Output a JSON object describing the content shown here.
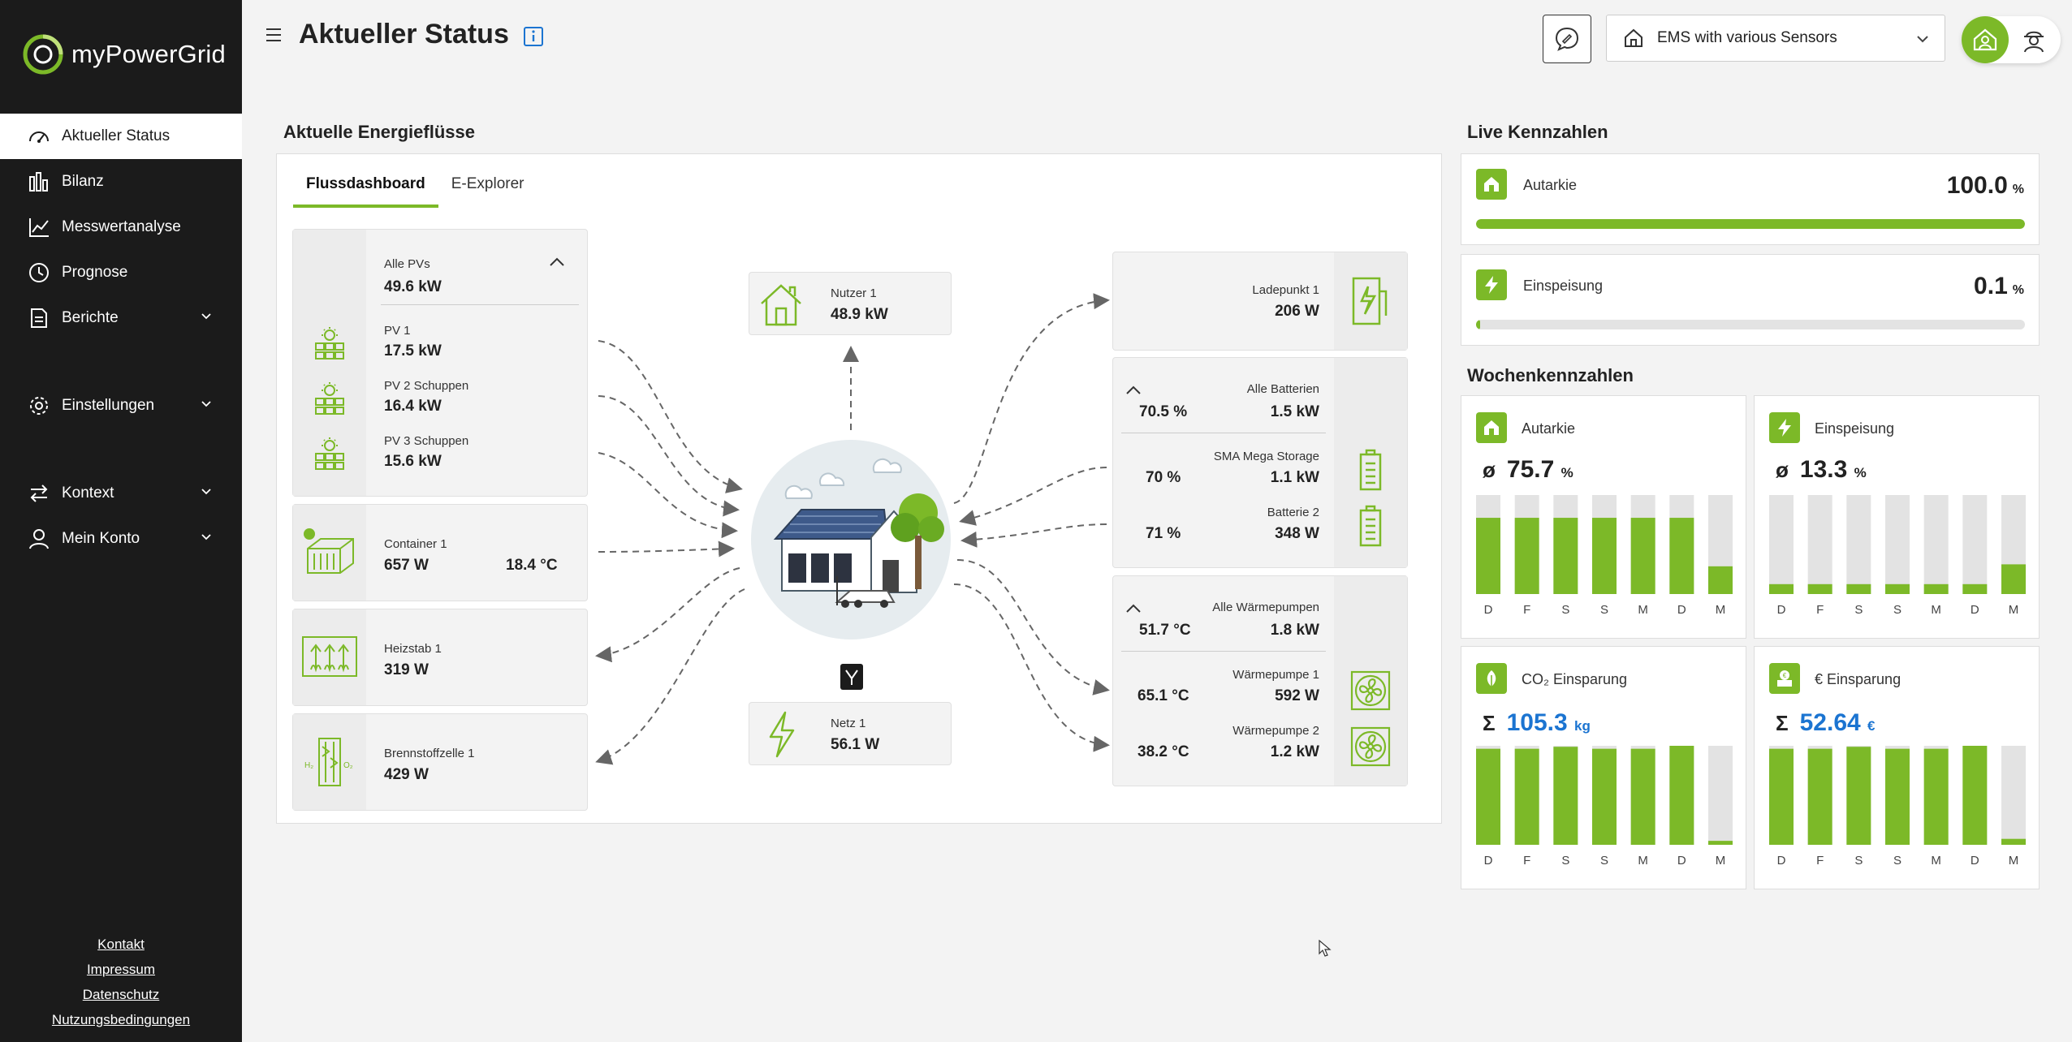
{
  "app": {
    "name": "myPowerGrid"
  },
  "sidebar": {
    "items": [
      {
        "label": "Aktueller Status",
        "icon": "gauge-icon",
        "active": true
      },
      {
        "label": "Bilanz",
        "icon": "bar-chart-icon"
      },
      {
        "label": "Messwertanalyse",
        "icon": "line-chart-icon"
      },
      {
        "label": "Prognose",
        "icon": "clock-icon"
      },
      {
        "label": "Berichte",
        "icon": "document-icon",
        "expandable": true
      },
      {
        "label": "Einstellungen",
        "icon": "gear-icon",
        "expandable": true
      },
      {
        "label": "Kontext",
        "icon": "swap-icon",
        "expandable": true
      },
      {
        "label": "Mein Konto",
        "icon": "user-icon",
        "expandable": true
      }
    ],
    "footer": [
      "Kontakt",
      "Impressum",
      "Datenschutz",
      "Nutzungsbedingungen"
    ]
  },
  "header": {
    "title": "Aktueller Status",
    "site_select": "EMS with various Sensors"
  },
  "flows": {
    "section_title": "Aktuelle Energieflüsse",
    "tabs": [
      "Flussdashboard",
      "E-Explorer"
    ],
    "pv": {
      "title": "Alle PVs",
      "total": "49.6 kW",
      "items": [
        {
          "name": "PV 1",
          "value": "17.5 kW"
        },
        {
          "name": "PV 2 Schuppen",
          "value": "16.4 kW"
        },
        {
          "name": "PV 3 Schuppen",
          "value": "15.6 kW"
        }
      ]
    },
    "container": {
      "name": "Container 1",
      "value": "657 W",
      "temp": "18.4 °C"
    },
    "heater": {
      "name": "Heizstab 1",
      "value": "319 W"
    },
    "fuelcell": {
      "name": "Brennstoffzelle 1",
      "value": "429 W"
    },
    "consumer": {
      "name": "Nutzer 1",
      "value": "48.9 kW"
    },
    "grid": {
      "name": "Netz 1",
      "value": "56.1 W"
    },
    "charger": {
      "name": "Ladepunkt 1",
      "value": "206 W"
    },
    "batteries": {
      "title": "Alle Batterien",
      "soc": "70.5 %",
      "total": "1.5 kW",
      "items": [
        {
          "name": "SMA Mega Storage",
          "soc": "70 %",
          "value": "1.1 kW"
        },
        {
          "name": "Batterie 2",
          "soc": "71 %",
          "value": "348 W"
        }
      ]
    },
    "heatpumps": {
      "title": "Alle Wärmepumpen",
      "temp": "51.7 °C",
      "total": "1.8 kW",
      "items": [
        {
          "name": "Wärmepumpe 1",
          "temp": "65.1 °C",
          "value": "592 W"
        },
        {
          "name": "Wärmepumpe 2",
          "temp": "38.2 °C",
          "value": "1.2 kW"
        }
      ]
    }
  },
  "live": {
    "section_title": "Live Kennzahlen",
    "autarkie": {
      "name": "Autarkie",
      "value": "100.0",
      "unit": "%",
      "fraction": 1.0
    },
    "einspeisung": {
      "name": "Einspeisung",
      "value": "0.1",
      "unit": "%",
      "fraction": 0.001
    }
  },
  "weekly": {
    "section_title": "Wochenkennzahlen",
    "days": [
      "D",
      "F",
      "S",
      "S",
      "M",
      "D",
      "M"
    ],
    "cards": [
      {
        "name": "Autarkie",
        "symbol": "ø",
        "value": "75.7",
        "unit": "%",
        "blue": false,
        "values": [
          0.77,
          0.77,
          0.77,
          0.77,
          0.77,
          0.77,
          0.28
        ]
      },
      {
        "name": "Einspeisung",
        "symbol": "ø",
        "value": "13.3",
        "unit": "%",
        "blue": false,
        "values": [
          0.1,
          0.1,
          0.1,
          0.1,
          0.1,
          0.1,
          0.3
        ]
      },
      {
        "name": "CO₂ Einsparung",
        "symbol": "Σ",
        "value": "105.3",
        "unit": "kg",
        "blue": true,
        "values": [
          0.97,
          0.97,
          0.99,
          0.97,
          0.97,
          1.0,
          0.04
        ]
      },
      {
        "name": "€ Einsparung",
        "symbol": "Σ",
        "value": "52.64",
        "unit": "€",
        "blue": true,
        "values": [
          0.97,
          0.97,
          0.99,
          0.97,
          0.97,
          1.0,
          0.06
        ]
      }
    ]
  }
}
